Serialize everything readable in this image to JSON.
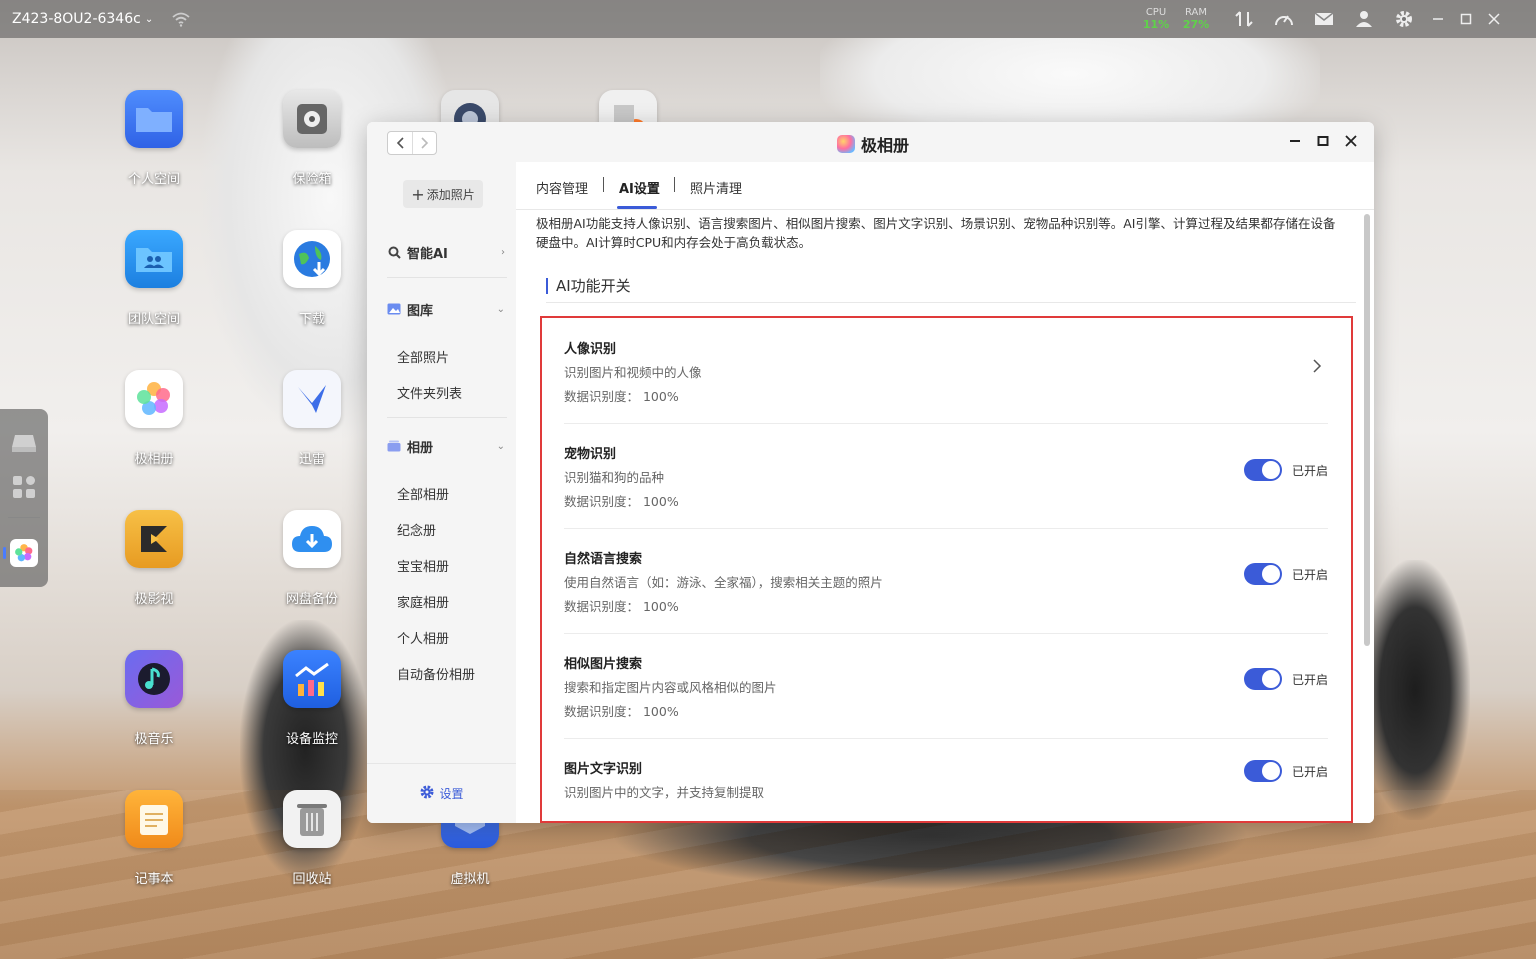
{
  "topbar": {
    "device_name": "Z423-8OU2-6346c",
    "cpu_label": "CPU",
    "cpu_value": "11%",
    "ram_label": "RAM",
    "ram_value": "27%",
    "meter_color": "#5fd24a"
  },
  "desktop": {
    "icons": [
      {
        "label": "个人空间",
        "icon": "folder-icon"
      },
      {
        "label": "保险箱",
        "icon": "safe-icon"
      },
      {
        "label": "团队空间",
        "icon": "team-folder-icon"
      },
      {
        "label": "下载",
        "icon": "download-globe-icon"
      },
      {
        "label": "极相册",
        "icon": "photos-icon"
      },
      {
        "label": "迅雷",
        "icon": "thunder-bird-icon"
      },
      {
        "label": "极影视",
        "icon": "video-icon"
      },
      {
        "label": "网盘备份",
        "icon": "cloud-backup-icon"
      },
      {
        "label": "极音乐",
        "icon": "music-icon"
      },
      {
        "label": "设备监控",
        "icon": "monitor-chart-icon"
      },
      {
        "label": "记事本",
        "icon": "notepad-icon"
      },
      {
        "label": "回收站",
        "icon": "trash-icon"
      },
      {
        "label": "虚拟机",
        "icon": "vm-icon"
      }
    ]
  },
  "window": {
    "title": "极相册",
    "add_photo": "添加照片",
    "sidebar": {
      "smart_ai": "智能AI",
      "gallery": "图库",
      "gallery_items": [
        "全部照片",
        "文件夹列表"
      ],
      "albums": "相册",
      "album_items": [
        "全部相册",
        "纪念册",
        "宝宝相册",
        "家庭相册",
        "个人相册",
        "自动备份相册"
      ],
      "settings": "设置"
    },
    "tabs": [
      "内容管理",
      "AI设置",
      "照片清理"
    ],
    "description": "极相册AI功能支持人像识别、语言搜索图片、相似图片搜索、图片文字识别、场景识别、宠物品种识别等。AI引擎、计算过程及结果都存储在设备硬盘中。AI计算时CPU和内存会处于高负载状态。",
    "section_title": "AI功能开关",
    "features": [
      {
        "name": "人像识别",
        "desc": "识别图片和视频中的人像",
        "accuracy": "数据识别度： 100%"
      },
      {
        "name": "宠物识别",
        "desc": "识别猫和狗的品种",
        "accuracy": "数据识别度： 100%",
        "status": "已开启"
      },
      {
        "name": "自然语言搜索",
        "desc": "使用自然语言（如：游泳、全家福），搜索相关主题的照片",
        "accuracy": "数据识别度： 100%",
        "status": "已开启"
      },
      {
        "name": "相似图片搜索",
        "desc": "搜索和指定图片内容或风格相似的图片",
        "accuracy": "数据识别度： 100%",
        "status": "已开启"
      },
      {
        "name": "图片文字识别",
        "desc": "识别图片中的文字，并支持复制提取",
        "status": "已开启"
      }
    ],
    "accent_color": "#3b5bd8",
    "highlight_color": "#e03a3a"
  }
}
